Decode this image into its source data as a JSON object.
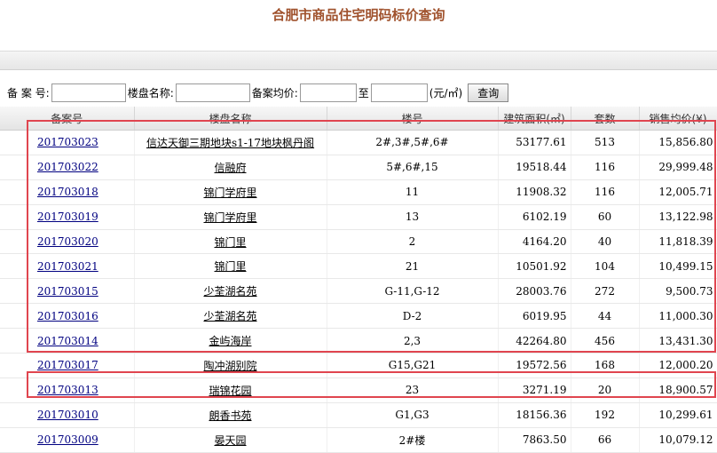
{
  "page": {
    "title": "合肥市商品住宅明码标价查询"
  },
  "search": {
    "record_label": "备 案 号:",
    "name_label": "楼盘名称:",
    "price_label": "备案均价:",
    "to_label": "至",
    "unit_label": "(元/㎡)",
    "button_label": "查询",
    "record_value": "",
    "name_value": "",
    "price_from": "",
    "price_to": ""
  },
  "table": {
    "headers": [
      "备案号",
      "楼盘名称",
      "楼号",
      "建筑面积(㎡)",
      "套数",
      "销售均价(¥)"
    ],
    "rows": [
      {
        "record": "201703023",
        "name": "信达天御三期地块s1-17地块枫丹阁",
        "building": "2#,3#,5#,6#",
        "area": "53177.61",
        "units": "513",
        "price": "15,856.80"
      },
      {
        "record": "201703022",
        "name": "信融府",
        "building": "5#,6#,15",
        "area": "19518.44",
        "units": "116",
        "price": "29,999.48"
      },
      {
        "record": "201703018",
        "name": "锦门学府里",
        "building": "11",
        "area": "11908.32",
        "units": "116",
        "price": "12,005.71"
      },
      {
        "record": "201703019",
        "name": "锦门学府里",
        "building": "13",
        "area": "6102.19",
        "units": "60",
        "price": "13,122.98"
      },
      {
        "record": "201703020",
        "name": "锦门里",
        "building": "2",
        "area": "4164.20",
        "units": "40",
        "price": "11,818.39"
      },
      {
        "record": "201703021",
        "name": "锦门里",
        "building": "21",
        "area": "10501.92",
        "units": "104",
        "price": "10,499.15"
      },
      {
        "record": "201703015",
        "name": "少荃湖名苑",
        "building": "G-11,G-12",
        "area": "28003.76",
        "units": "272",
        "price": "9,500.73"
      },
      {
        "record": "201703016",
        "name": "少荃湖名苑",
        "building": "D-2",
        "area": "6019.95",
        "units": "44",
        "price": "11,000.30"
      },
      {
        "record": "201703014",
        "name": "金屿海岸",
        "building": "2,3",
        "area": "42264.80",
        "units": "456",
        "price": "13,431.30"
      },
      {
        "record": "201703017",
        "name": "陶冲湖别院",
        "building": "G15,G21",
        "area": "19572.56",
        "units": "168",
        "price": "12,000.20"
      },
      {
        "record": "201703013",
        "name": "瑞锦花园",
        "building": "23",
        "area": "3271.19",
        "units": "20",
        "price": "18,900.57"
      },
      {
        "record": "201703010",
        "name": "朗香书苑",
        "building": "G1,G3",
        "area": "18156.36",
        "units": "192",
        "price": "10,299.61"
      },
      {
        "record": "201703009",
        "name": "晏天园",
        "building": "2#楼",
        "area": "7863.50",
        "units": "66",
        "price": "10,079.12"
      }
    ]
  },
  "colors": {
    "title": "#a0522d",
    "highlight": "#e0454f",
    "link": "#000080"
  }
}
